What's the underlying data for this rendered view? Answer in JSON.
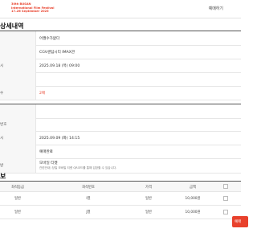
{
  "header": {
    "logo_lines": [
      "30th BUSAN",
      "International Film Festival",
      "17–26 September 2025"
    ],
    "link": "예매하기"
  },
  "page_title": "상세내역",
  "details": [
    {
      "label": "",
      "value": "어쩔수가없다",
      "red": false
    },
    {
      "label": "",
      "value": "CGV센텀시티 IMAX관",
      "red": false
    },
    {
      "label": "시",
      "value": "2025.09.18 (목) 09:00",
      "red": false
    },
    {
      "label": "",
      "value": "",
      "red": false
    },
    {
      "label": "수",
      "value": "2매",
      "red": true
    },
    {
      "label": "",
      "value": "",
      "red": false
    },
    {
      "label": "번호",
      "value": "",
      "red": false
    },
    {
      "label": "시",
      "value": "2025.09.09 (화) 14:15",
      "red": false
    },
    {
      "label": "",
      "value": "예매완료",
      "red": false
    },
    {
      "label": "방",
      "value": "모바일 티켓",
      "sub": "관련안내) 당일 모바일 티켓 QR코드를 통해 입장할 수 있습니다.",
      "red": false
    }
  ],
  "seat_section_title": "보",
  "seat_table": {
    "headers": [
      "좌석등급",
      "좌석번호",
      "가격",
      "금액"
    ],
    "rows": [
      {
        "grade": "일반",
        "seat": "I열",
        "price": "일반",
        "amount": "10,000원"
      },
      {
        "grade": "일반",
        "seat": "J열",
        "price": "일반",
        "amount": "10,000원"
      }
    ]
  },
  "action_button": "예매"
}
